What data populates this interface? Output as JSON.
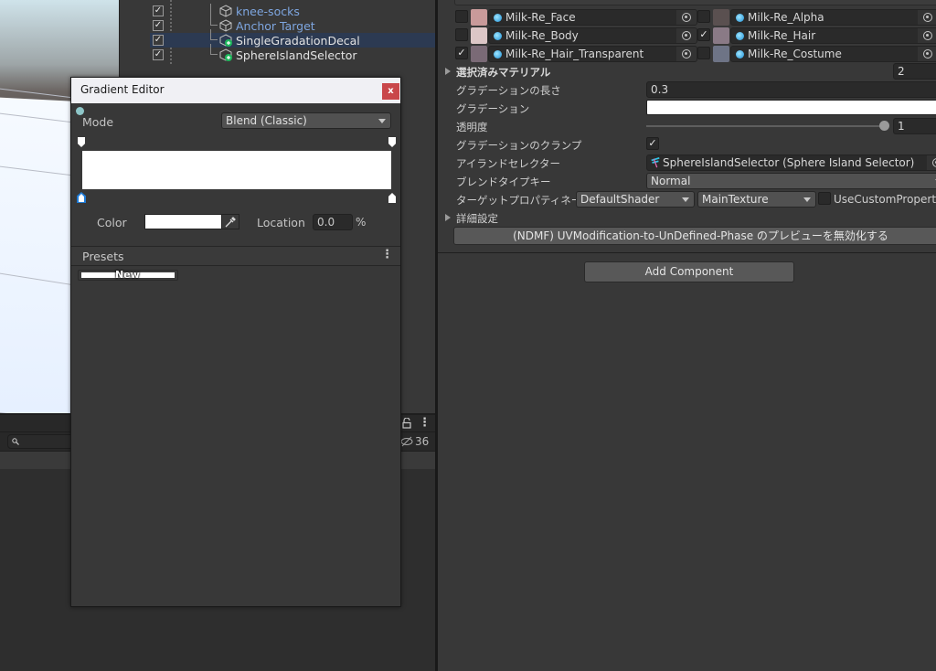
{
  "hierarchy": {
    "items": [
      {
        "label": "knee-socks",
        "style": "prefab",
        "checked": true,
        "selected": false,
        "right_icon": "visibility-prefab-icon"
      },
      {
        "label": "Anchor Target",
        "style": "prefab",
        "checked": true,
        "selected": false,
        "right_icon": ""
      },
      {
        "label": "SingleGradationDecal",
        "style": "added",
        "checked": true,
        "selected": true,
        "right_icon": "tool-pin-icon"
      },
      {
        "label": "SphereIslandSelector",
        "style": "added",
        "checked": true,
        "selected": false,
        "right_icon": "tool-pin-icon"
      }
    ]
  },
  "project": {
    "hidden_count": "36",
    "search_placeholder": ""
  },
  "gradient_editor": {
    "title": "Gradient Editor",
    "close_label": "x",
    "mode_label": "Mode",
    "mode_value": "Blend (Classic)",
    "color_label": "Color",
    "color_value": "#FFFFFF",
    "location_label": "Location",
    "location_value": "0.0",
    "location_unit": "%",
    "presets_label": "Presets",
    "new_preset_label": "New"
  },
  "inspector": {
    "materials": [
      {
        "left": {
          "name": "Milk-Re_Face",
          "checked": false,
          "thumb": "#c99a9a"
        },
        "right": {
          "name": "Milk-Re_Alpha",
          "checked": false,
          "thumb": "#5a5050"
        }
      },
      {
        "left": {
          "name": "Milk-Re_Body",
          "checked": false,
          "thumb": "#dcc6c6"
        },
        "right": {
          "name": "Milk-Re_Hair",
          "checked": true,
          "thumb": "#8a7a86"
        }
      },
      {
        "left": {
          "name": "Milk-Re_Hair_Transparent",
          "checked": true,
          "thumb": "#7a6a76"
        },
        "right": {
          "name": "Milk-Re_Costume",
          "checked": false,
          "thumb": "#6e7486"
        }
      }
    ],
    "selected_materials_label": "選択済みマテリアル",
    "selected_materials_count": "2",
    "properties": {
      "gradation_length_label": "グラデーションの長さ",
      "gradation_length_value": "0.3",
      "gradation_label": "グラデーション",
      "gradation_color": "#FFFFFF",
      "alpha_label": "透明度",
      "alpha_value": "1",
      "alpha_fraction": 1.0,
      "clamp_label": "グラデーションのクランプ",
      "clamp_checked": true,
      "island_selector_label": "アイランドセレクター",
      "island_selector_value": "SphereIslandSelector (Sphere Island Selector)",
      "blend_type_label": "ブレンドタイプキー",
      "blend_type_value": "Normal",
      "target_property_label": "ターゲットプロパティネーム",
      "target_shader_value": "DefaultShader",
      "target_texture_value": "MainTexture",
      "use_custom_property_label": "UseCustomProperty",
      "use_custom_property_checked": false,
      "advanced_label": "詳細設定"
    },
    "ndmf_button_label": "(NDMF) UVModification-to-UnDefined-Phase のプレビューを無効化する",
    "add_component_label": "Add Component"
  }
}
